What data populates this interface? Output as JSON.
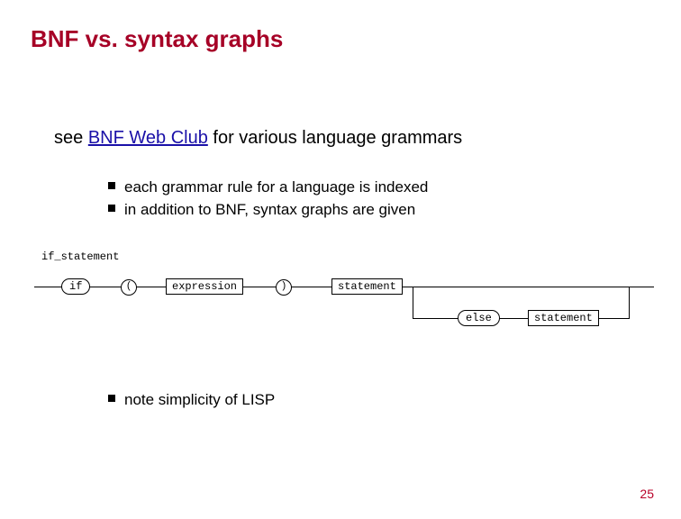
{
  "title": "BNF vs. syntax graphs",
  "intro": {
    "prefix": "see ",
    "link": "BNF Web Club",
    "suffix": " for various language grammars"
  },
  "bullets_top": [
    "each grammar rule for a language is indexed",
    "in addition to BNF, syntax graphs are given"
  ],
  "bullets_bottom": [
    "note simplicity of LISP"
  ],
  "diagram": {
    "label": "if_statement",
    "if": "if",
    "lparen": "(",
    "expression": "expression",
    "rparen": ")",
    "statement1": "statement",
    "else": "else",
    "statement2": "statement"
  },
  "page_number": "25"
}
